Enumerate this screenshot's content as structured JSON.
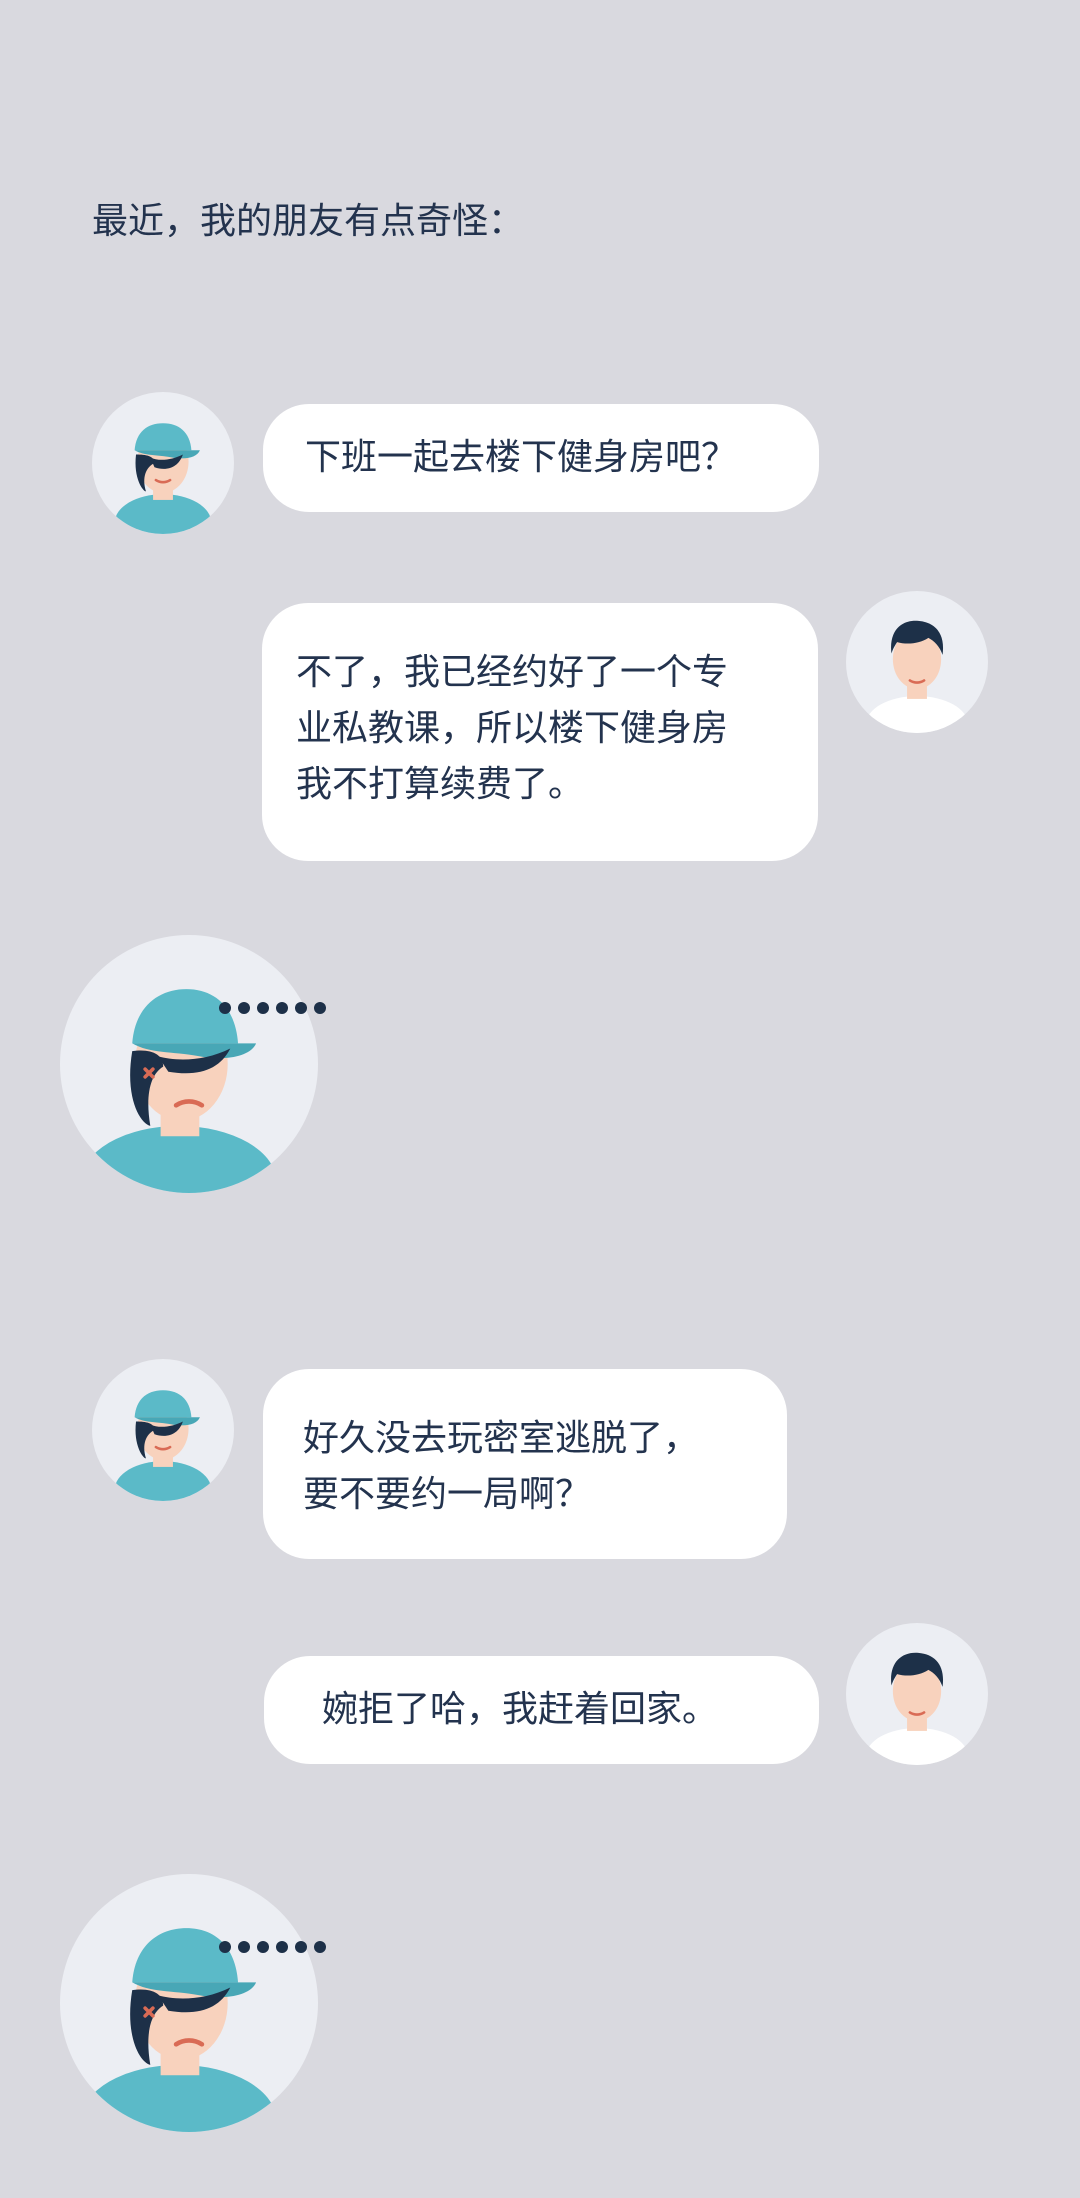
{
  "intro": "最近，我的朋友有点奇怪：",
  "colors": {
    "background": "#d9d9df",
    "bubble": "#ffffff",
    "text": "#23334e",
    "teal": "#5bbac8",
    "hair": "#1d3048",
    "skin": "#f8d2bd"
  },
  "messages": [
    {
      "side": "left",
      "avatar": "friend-avatar-cap-icon",
      "lines": [
        "下班一起去楼下健身房吧？"
      ]
    },
    {
      "side": "right",
      "avatar": "me-avatar-icon",
      "lines": [
        "不了，我已经约好了一个专",
        "业私教课，所以楼下健身房",
        "我不打算续费了。"
      ]
    },
    {
      "side": "left",
      "avatar": "friend-frowning-avatar-icon",
      "ellipsis": "······"
    },
    {
      "side": "left",
      "avatar": "friend-avatar-cap-icon",
      "lines": [
        "好久没去玩密室逃脱了，",
        "要不要约一局啊？"
      ]
    },
    {
      "side": "right",
      "avatar": "me-avatar-icon",
      "lines": [
        "婉拒了哈，我赶着回家。"
      ]
    },
    {
      "side": "left",
      "avatar": "friend-frowning-avatar-icon",
      "ellipsis": "······"
    }
  ]
}
